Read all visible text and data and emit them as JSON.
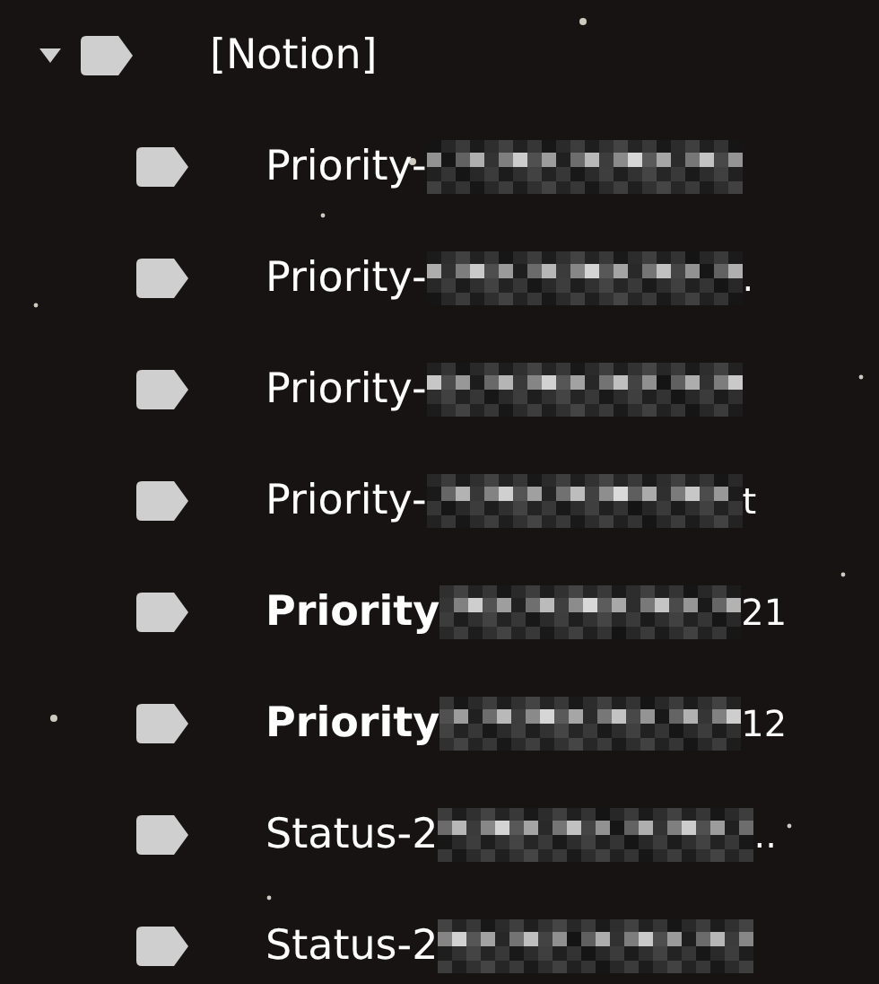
{
  "label_tree": {
    "label": "[Notion]",
    "expanded": true,
    "children": [
      {
        "label": "Priority-",
        "bold": false
      },
      {
        "label": "Priority-",
        "bold": false,
        "tail": "."
      },
      {
        "label": "Priority-",
        "bold": false
      },
      {
        "label": "Priority-",
        "bold": false,
        "tail": "t"
      },
      {
        "label": "Priority",
        "bold": true,
        "count": "21"
      },
      {
        "label": "Priority",
        "bold": true,
        "count": "12"
      },
      {
        "label": "Status-2",
        "bold": false,
        "tail": ".."
      },
      {
        "label": "Status-2",
        "bold": false
      }
    ]
  }
}
